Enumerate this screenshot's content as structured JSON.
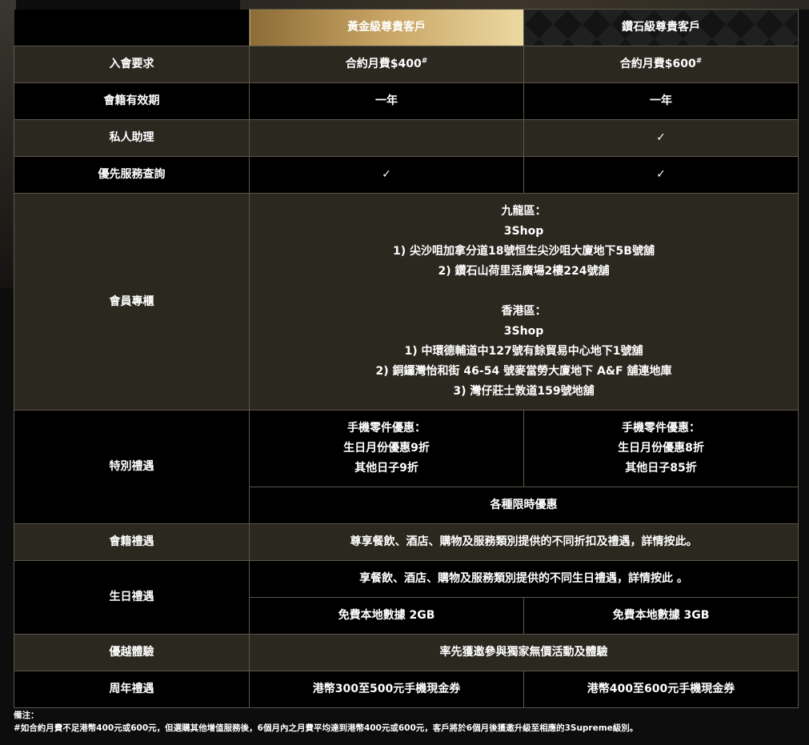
{
  "header": {
    "gold_tier": "黃金級尊貴客戶",
    "diamond_tier": "鑽石級尊貴客戶"
  },
  "rows": {
    "membership_req": {
      "label": "入會要求",
      "gold": "合約月費$400",
      "diamond": "合約月費$600",
      "mark": "#"
    },
    "validity": {
      "label": "會籍有效期",
      "gold": "一年",
      "diamond": "一年"
    },
    "assistant": {
      "label": "私人助理",
      "gold": "",
      "diamond": "✓"
    },
    "priority": {
      "label": "優先服務查詢",
      "gold": "✓",
      "diamond": "✓"
    },
    "counter": {
      "label": "會員專櫃",
      "kowloon_title": "九龍區：",
      "kowloon_shop": "3Shop",
      "kowloon_1": "1) 尖沙咀加拿分道18號恒生尖沙咀大廈地下5B號舖",
      "kowloon_2": "2) 鑽石山荷里活廣場2樓224號舖",
      "hk_title": "香港區：",
      "hk_shop": "3Shop",
      "hk_1": "1) 中環德輔道中127號有餘貿易中心地下1號舖",
      "hk_2": "2) 銅鑼灣怡和街 46-54 號麥當勞大廈地下 A&F 舖連地庫",
      "hk_3": "3) 灣仔莊士敦道159號地舖"
    },
    "special": {
      "label": "特別禮遇",
      "gold_title": "手機零件優惠：",
      "gold_bday": "生日月份優惠9折",
      "gold_other": "其他日子9折",
      "diamond_title": "手機零件優惠：",
      "diamond_bday": "生日月份優惠8折",
      "diamond_other": "其他日子85折",
      "limited": "各種限時優惠"
    },
    "membership_perks": {
      "label": "會籍禮遇",
      "text": "尊享餐飲、酒店、購物及服務類別提供的不同折扣及禮遇，詳情按此。"
    },
    "birthday": {
      "label": "生日禮遇",
      "text": "享餐飲、酒店、購物及服務類別提供的不同生日禮遇，詳情按此 。",
      "gold_data": "免費本地數據 2GB",
      "diamond_data": "免費本地數據 3GB"
    },
    "experience": {
      "label": "優越體驗",
      "text": "率先獲邀參與獨家無價活動及體驗"
    },
    "anniversary": {
      "label": "周年禮遇",
      "gold": "港幣300至500元手機現金券",
      "diamond": "港幣400至600元手機現金券"
    }
  },
  "notes": {
    "title": "備注：",
    "text": "#如合約月費不足港幣400元或600元，但選購其他增值服務後，6個月內之月費平均達到港幣400元或600元，客戶將於6個月後獲邀升級至相應的3Supreme級別。"
  }
}
